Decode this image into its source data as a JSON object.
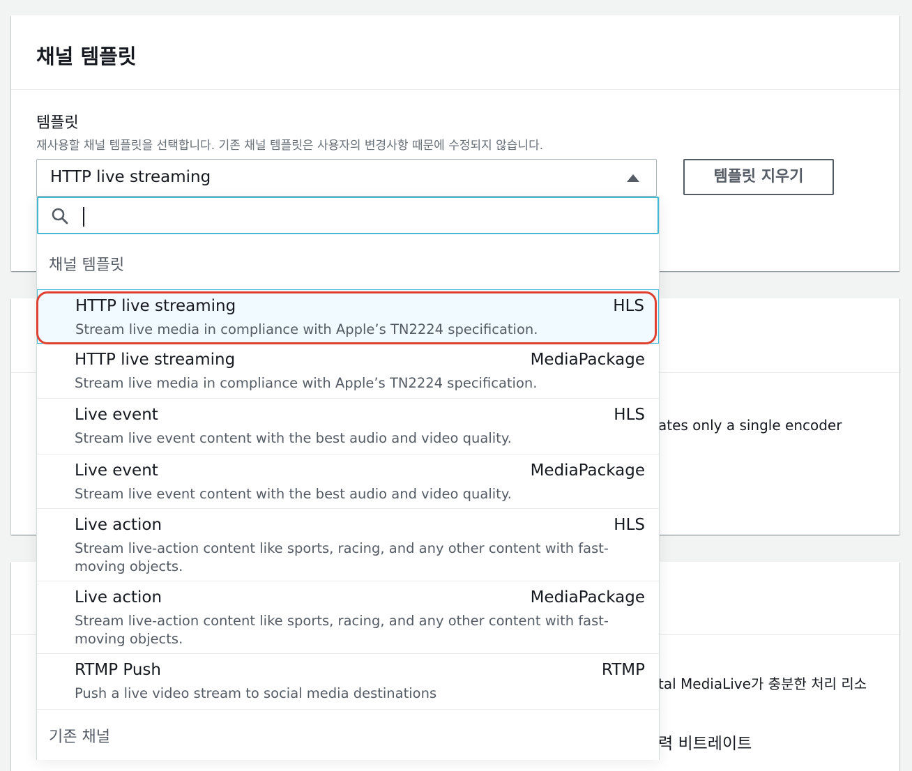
{
  "panel_title": "채널 템플릿",
  "template_field": {
    "label": "템플릿",
    "description": "재사용할 채널 템플릿을 선택합니다. 기존 채널 템플릿은 사용자의 변경사항 때문에 수정되지 않습니다.",
    "selected_value": "HTTP live streaming",
    "clear_button": "템플릿 지우기"
  },
  "search": {
    "value": "",
    "placeholder": ""
  },
  "dropdown": {
    "group_channel_templates": "채널 템플릿",
    "options": [
      {
        "title": "HTTP live streaming",
        "tag": "HLS",
        "description": "Stream live media in compliance with Apple’s TN2224 specification.",
        "selected": true
      },
      {
        "title": "HTTP live streaming",
        "tag": "MediaPackage",
        "description": "Stream live media in compliance with Apple’s TN2224 specification."
      },
      {
        "title": "Live event",
        "tag": "HLS",
        "description": "Stream live event content with the best audio and video quality."
      },
      {
        "title": "Live event",
        "tag": "MediaPackage",
        "description": "Stream live event content with the best audio and video quality."
      },
      {
        "title": "Live action",
        "tag": "HLS",
        "description": "Stream live-action content like sports, racing, and any other content with fast-moving objects."
      },
      {
        "title": "Live action",
        "tag": "MediaPackage",
        "description": "Stream live-action content like sports, racing, and any other content with fast-moving objects."
      },
      {
        "title": "RTMP Push",
        "tag": "RTMP",
        "description": "Push a live video stream to social media destinations"
      }
    ],
    "group_existing_channels": "기존 채널"
  },
  "background_text": {
    "panel2_text": "ates only a single encoder",
    "panel3_text_1": "tal MediaLive가 충분한 처리 리소",
    "panel3_text_2": "력 비트레이트"
  },
  "colors": {
    "focus_blue": "#44b9d6",
    "highlight_red": "#e0402f",
    "selected_bg": "#f1faff"
  }
}
